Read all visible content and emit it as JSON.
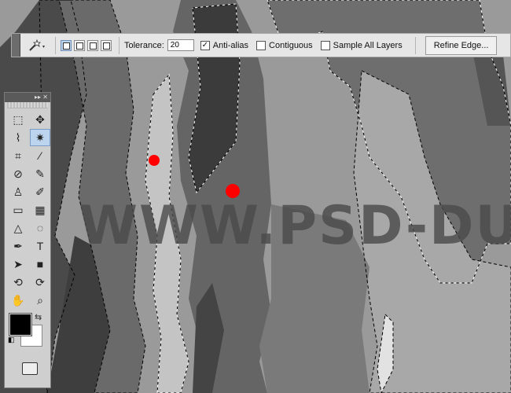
{
  "options_bar": {
    "tool_icon": "magic-wand-icon",
    "selection_modes": [
      {
        "name": "new-selection",
        "icon": "new-selection-icon",
        "active": true
      },
      {
        "name": "add-to-selection",
        "icon": "add-selection-icon",
        "active": false
      },
      {
        "name": "subtract-from-selection",
        "icon": "subtract-selection-icon",
        "active": false
      },
      {
        "name": "intersect-with-selection",
        "icon": "intersect-selection-icon",
        "active": false
      }
    ],
    "tolerance_label": "Tolerance:",
    "tolerance_value": "20",
    "anti_alias_label": "Anti-alias",
    "anti_alias_checked": true,
    "contiguous_label": "Contiguous",
    "contiguous_checked": false,
    "sample_all_layers_label": "Sample All Layers",
    "sample_all_layers_checked": false,
    "refine_edge_label": "Refine Edge..."
  },
  "toolbox": {
    "header_glyphs": "▸▸ ✕",
    "tools": [
      {
        "name": "marquee",
        "icon": "rect-marquee-icon",
        "glyph": "⬚"
      },
      {
        "name": "move",
        "icon": "move-icon",
        "glyph": "✥"
      },
      {
        "name": "lasso",
        "icon": "polygonal-lasso-icon",
        "glyph": "⌇"
      },
      {
        "name": "magic-wand",
        "icon": "magic-wand-icon",
        "glyph": "✷",
        "active": true
      },
      {
        "name": "crop",
        "icon": "crop-icon",
        "glyph": "⌗"
      },
      {
        "name": "eyedropper",
        "icon": "eyedropper-icon",
        "glyph": "⁄"
      },
      {
        "name": "healing-brush",
        "icon": "bandage-icon",
        "glyph": "⊘"
      },
      {
        "name": "brush",
        "icon": "brush-icon",
        "glyph": "✎"
      },
      {
        "name": "clone-stamp",
        "icon": "stamp-icon",
        "glyph": "♙"
      },
      {
        "name": "history-brush",
        "icon": "history-brush-icon",
        "glyph": "✐"
      },
      {
        "name": "eraser",
        "icon": "eraser-icon",
        "glyph": "▭"
      },
      {
        "name": "gradient",
        "icon": "gradient-icon",
        "glyph": "▦"
      },
      {
        "name": "blur",
        "icon": "blur-icon",
        "glyph": "△"
      },
      {
        "name": "dodge",
        "icon": "dodge-icon",
        "glyph": "◌"
      },
      {
        "name": "pen",
        "icon": "pen-icon",
        "glyph": "✒"
      },
      {
        "name": "type",
        "icon": "type-icon",
        "glyph": "T"
      },
      {
        "name": "path-selection",
        "icon": "arrow-icon",
        "glyph": "➤"
      },
      {
        "name": "shape",
        "icon": "rectangle-shape-icon",
        "glyph": "■"
      },
      {
        "name": "3d-rotate",
        "icon": "3d-rotate-icon",
        "glyph": "⟲"
      },
      {
        "name": "3d-orbit",
        "icon": "3d-orbit-icon",
        "glyph": "⟳"
      },
      {
        "name": "hand",
        "icon": "hand-icon",
        "glyph": "✋"
      },
      {
        "name": "zoom",
        "icon": "zoom-icon",
        "glyph": "⌕"
      }
    ],
    "foreground_color": "#000000",
    "background_color": "#ffffff"
  },
  "canvas": {
    "watermark_text": "WWW.PSD-DUDE.COM",
    "marker_color": "#ff0000"
  }
}
